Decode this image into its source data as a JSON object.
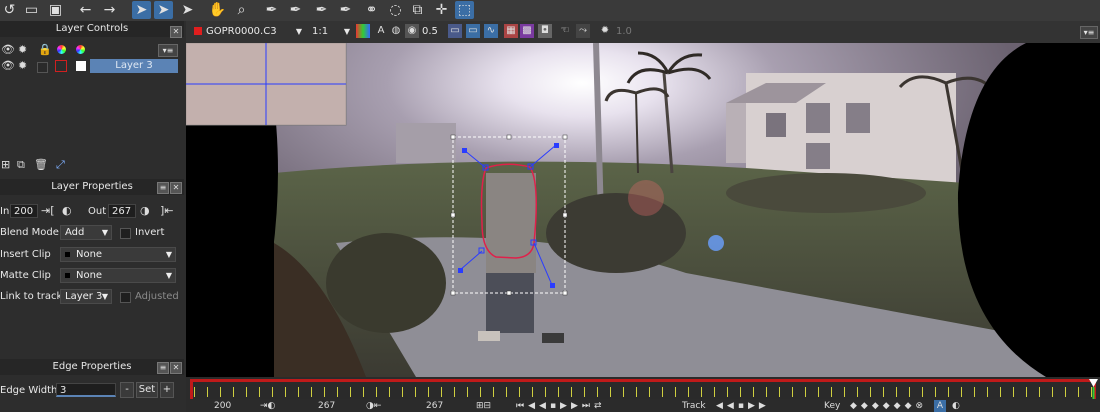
{
  "colors": {
    "accent": "#3b6ea5",
    "timeline_red": "#c01a1a",
    "shape": "#e0204a",
    "handle": "#2a3cff"
  },
  "toolbar": {
    "icons": [
      "undo-icon",
      "open-icon",
      "save-icon",
      "back-arrow-icon",
      "forward-arrow-icon",
      "select-arrow-icon",
      "select-b-icon",
      "select-plus-icon",
      "hand-icon",
      "zoom-icon",
      "pen-x-icon",
      "pen-plus-icon",
      "pen-b-icon",
      "pen-b-plus-icon",
      "link-icon",
      "lasso-icon",
      "transform-icon",
      "move-icon",
      "rect-select-icon"
    ]
  },
  "layer_controls": {
    "title": "Layer Controls",
    "layers": [
      {
        "name": "Layer 3"
      }
    ]
  },
  "layer_properties": {
    "title": "Layer Properties",
    "in_label": "In",
    "in_value": "200",
    "out_label": "Out",
    "out_value": "267",
    "blend_mode_label": "Blend Mode",
    "blend_mode_value": "Add",
    "invert_label": "Invert",
    "insert_clip_label": "Insert Clip",
    "insert_clip_value": "None",
    "matte_clip_label": "Matte Clip",
    "matte_clip_value": "None",
    "link_to_track_label": "Link to track",
    "link_to_track_value": "Layer 3",
    "adjusted_label": "Adjusted"
  },
  "edge_properties": {
    "title": "Edge Properties",
    "edge_width_label": "Edge Width",
    "edge_width_value": "3",
    "minus_label": "-",
    "set_label": "Set",
    "plus_label": "+"
  },
  "viewer_bar": {
    "clip_name": "GOPR0000.C3",
    "zoom": "1:1",
    "opacity": "0.5",
    "frame": "1.0"
  },
  "bottom_bar": {
    "in_value": "200",
    "mid_value": "267",
    "out_value": "267",
    "track_label": "Track",
    "key_label": "Key"
  }
}
